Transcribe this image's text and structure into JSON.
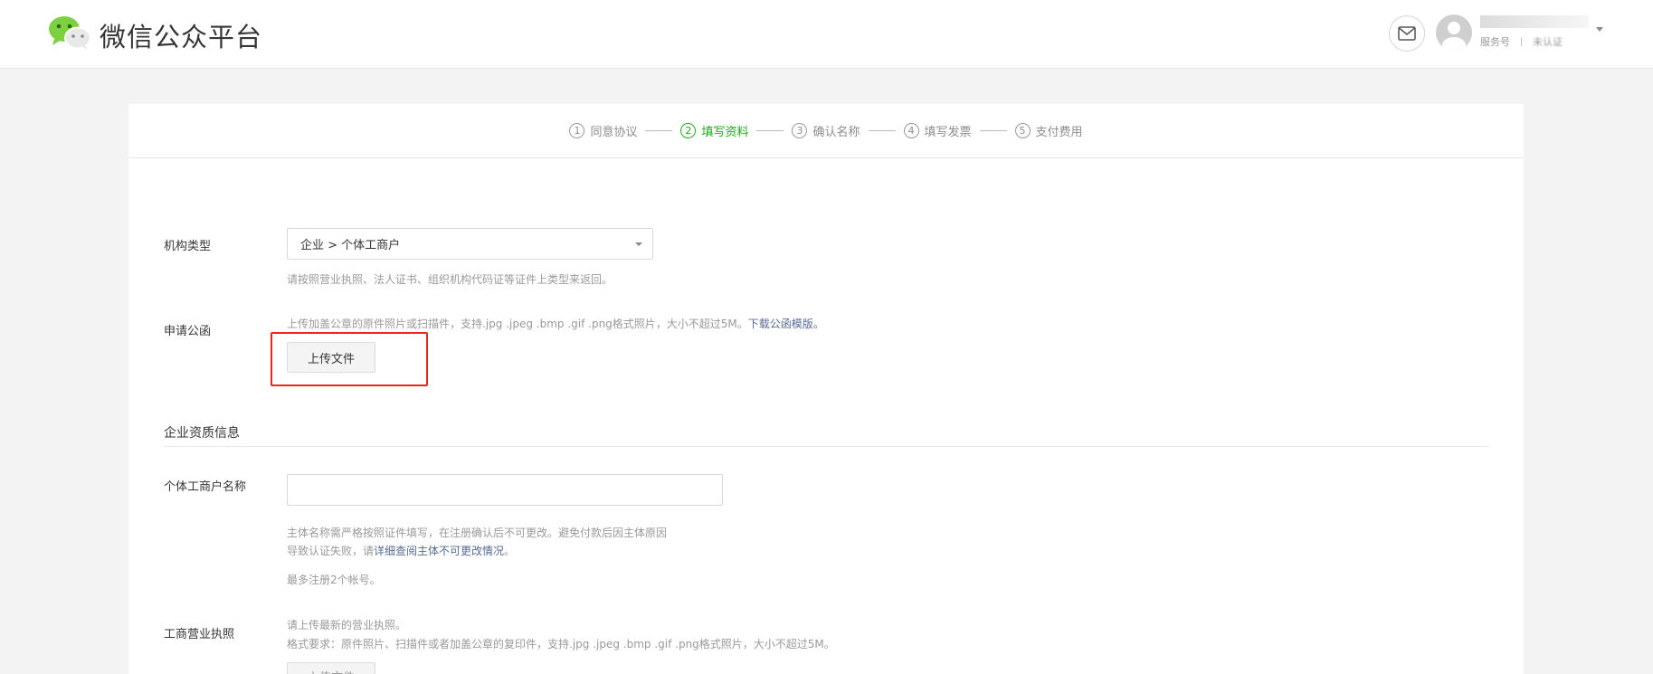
{
  "header": {
    "brand": "微信公众平台",
    "account_type": "服务号",
    "account_status": "未认证"
  },
  "steps": [
    {
      "num": "1",
      "label": "同意协议",
      "active": false
    },
    {
      "num": "2",
      "label": "填写资料",
      "active": true
    },
    {
      "num": "3",
      "label": "确认名称",
      "active": false
    },
    {
      "num": "4",
      "label": "填写发票",
      "active": false
    },
    {
      "num": "5",
      "label": "支付费用",
      "active": false
    }
  ],
  "form": {
    "org_type": {
      "label": "机构类型",
      "value": "企业 > 个体工商户",
      "tip": "请按照营业执照、法人证书、组织机构代码证等证件上类型来返回。"
    },
    "letter": {
      "label": "申请公函",
      "tip": "上传加盖公章的原件照片或扫描件，支持.jpg .jpeg .bmp .gif .png格式照片，大小不超过5M。",
      "tip_link": "下载公函模版。",
      "upload_label": "上传文件"
    },
    "section_title": "企业资质信息",
    "business_name": {
      "label": "个体工商户名称",
      "value": "",
      "tip_line1": "主体名称需严格按照证件填写，在注册确认后不可更改。避免付款后因主体原因",
      "tip_line2": "导致认证失败，请",
      "tip_link": "详细查阅主体不可更改情况",
      "tip_line2_end": "。",
      "tip_line3": "最多注册2个帐号。"
    },
    "license": {
      "label": "工商营业执照",
      "tip_line1": "请上传最新的营业执照。",
      "tip_line2": "格式要求：原件照片、扫描件或者加盖公章的复印件，支持.jpg .jpeg .bmp .gif .png格式照片，大小不超过5M。",
      "upload_label": "上传文件"
    }
  },
  "colors": {
    "accent_green": "#1aad19",
    "link_blue": "#576b95",
    "highlight_red": "#e8271d"
  }
}
